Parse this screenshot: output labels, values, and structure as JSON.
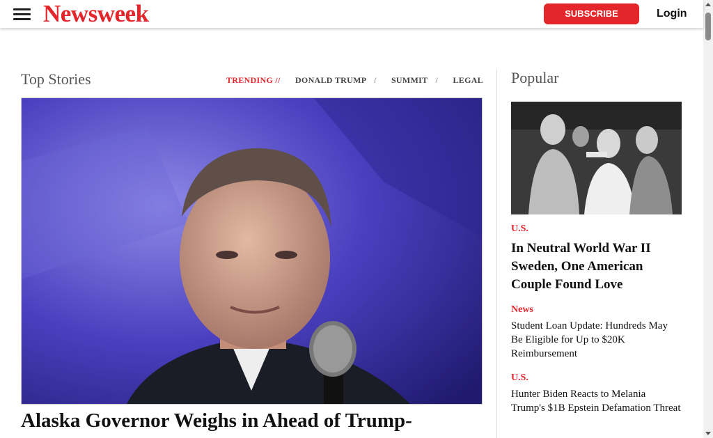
{
  "header": {
    "logo": "Newsweek",
    "subscribe_label": "SUBSCRIBE",
    "login_label": "Login"
  },
  "top_stories": {
    "title": "Top Stories",
    "trending_label": "TRENDING //",
    "trending_items": [
      "DONALD TRUMP",
      "SUMMIT",
      "LEGAL"
    ],
    "separator": "/",
    "hero_headline": "Alaska Governor Weighs in Ahead of Trump-"
  },
  "popular": {
    "title": "Popular",
    "items": [
      {
        "category": "U.S.",
        "headline": "In Neutral World War II Sweden, One American Couple Found Love"
      },
      {
        "category": "News",
        "headline": "Student Loan Update: Hundreds May Be Eligible for Up to $20K Reimbursement"
      },
      {
        "category": "U.S.",
        "headline": "Hunter Biden Reacts to Melania Trump's $1B Epstein Defamation Threat"
      }
    ]
  },
  "colors": {
    "brand_red": "#e4252a",
    "text": "#111111",
    "muted": "#555555"
  }
}
